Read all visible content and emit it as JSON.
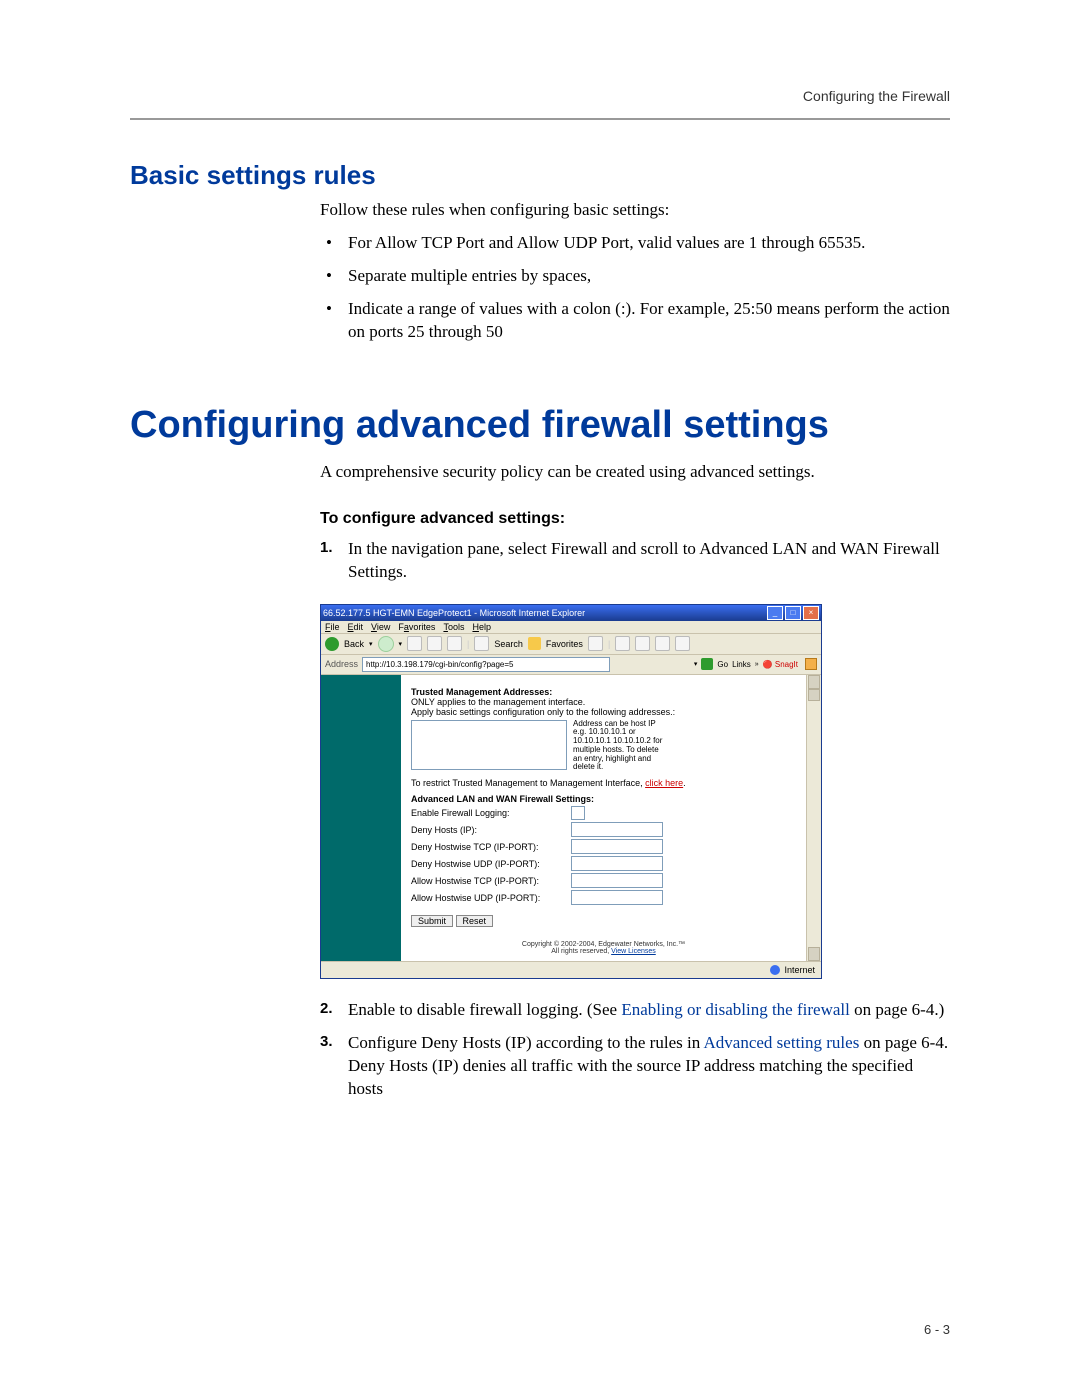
{
  "runningHead": "Configuring the Firewall",
  "h2_basic": "Basic settings rules",
  "basic_lead": "Follow these rules when configuring basic settings:",
  "basic_bullets": [
    "For Allow TCP Port and Allow UDP Port, valid values are 1 through 65535.",
    "Separate multiple entries by spaces,",
    "Indicate a range of values with a colon (:). For example, 25:50 means perform the action on ports 25 through 50"
  ],
  "h1_adv": "Configuring advanced firewall settings",
  "adv_lead": "A comprehensive security policy can be created using advanced settings.",
  "h3_proc": "To configure advanced settings:",
  "step1": "In the navigation pane, select Firewall and scroll to Advanced LAN and WAN Firewall Settings.",
  "step2_a": "Enable to disable firewall logging. (See ",
  "step2_link": "Enabling or disabling the firewall",
  "step2_b": " on page 6-4.)",
  "step3_a": "Configure Deny Hosts (IP) according to the rules in ",
  "step3_link": "Advanced setting rules",
  "step3_b": " on page 6-4. Deny Hosts (IP) denies all traffic with the source IP address matching the specified hosts",
  "pagenum": "6 - 3",
  "ie": {
    "title": "66.52.177.5 HGT-EMN EdgeProtect1 - Microsoft Internet Explorer",
    "menu": {
      "file": "File",
      "edit": "Edit",
      "view": "View",
      "fav": "Favorites",
      "tools": "Tools",
      "help": "Help"
    },
    "tb": {
      "back": "Back",
      "search": "Search",
      "favorites": "Favorites"
    },
    "addr_label": "Address",
    "addr_url": "http://10.3.198.179/cgi-bin/config?page=5",
    "go": "Go",
    "links": "Links",
    "snagit": "SnagIt",
    "trusted_title": "Trusted Management Addresses:",
    "trusted_l1": "ONLY applies to the management interface.",
    "trusted_l2": "Apply basic settings configuration only to the following addresses.:",
    "hint": "Address can be host IP e.g. 10.10.10.1 or 10.10.10.1 10.10.10.2 for multiple hosts. To delete an entry, highlight and delete it.",
    "restrict_a": "To restrict Trusted Management to Management Interface, ",
    "restrict_link": "click here",
    "adv_title": "Advanced LAN and WAN Firewall Settings:",
    "f_log": "Enable Firewall Logging:",
    "f_deny": "Deny Hosts (IP):",
    "f_dtcp": "Deny Hostwise TCP (IP-PORT):",
    "f_dudp": "Deny Hostwise UDP (IP-PORT):",
    "f_atcp": "Allow Hostwise TCP (IP-PORT):",
    "f_audp": "Allow Hostwise UDP (IP-PORT):",
    "submit": "Submit",
    "reset": "Reset",
    "copy_a": "Copyright © 2002-2004, Edgewater Networks, Inc.™",
    "copy_b": "All rights reserved, ",
    "copy_link": "View Licenses",
    "status": "Internet"
  }
}
